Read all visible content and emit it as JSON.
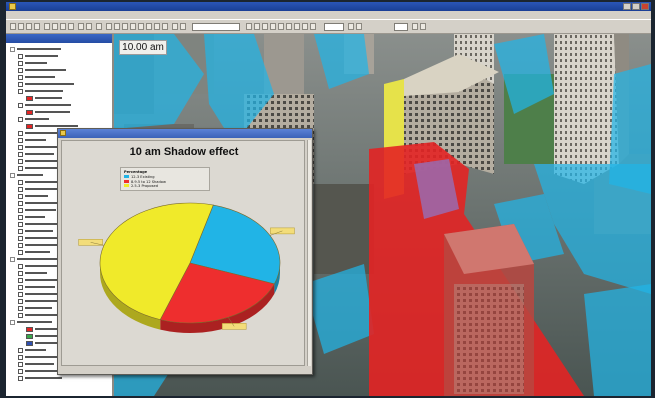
{
  "time_overlay": "10.00 am",
  "chart": {
    "title": "10 am Shadow effect",
    "legend_title": "Percentage",
    "legend_items": [
      {
        "label": "12-3 Existing",
        "color": "#21b4e6"
      },
      {
        "label": "8.9.5 to 12 Shadow",
        "color": "#ee2e2e"
      },
      {
        "label": "2.5-3 Proposed",
        "color": "#f0ea2a"
      }
    ]
  },
  "chart_data": {
    "type": "pie",
    "title": "10 am Shadow effect",
    "legend_title": "Percentage",
    "legend_position": "top",
    "categories": [
      "12-3 Existing",
      "8.9.5 to 12 Shadow",
      "2.5-3 Proposed"
    ],
    "values": [
      26.5,
      24.7,
      48.8
    ],
    "colors": [
      "#21b4e6",
      "#ee2e2e",
      "#f0ea2a"
    ]
  },
  "colors": {
    "shadow_existing": "#21b4e6",
    "shadow_proposed": "#e32424",
    "proposed_wall": "#e6e24a"
  },
  "icons": [
    "app-icon",
    "minimize-icon",
    "maximize-icon",
    "close-icon",
    "expand-icon",
    "checkbox-icon"
  ]
}
